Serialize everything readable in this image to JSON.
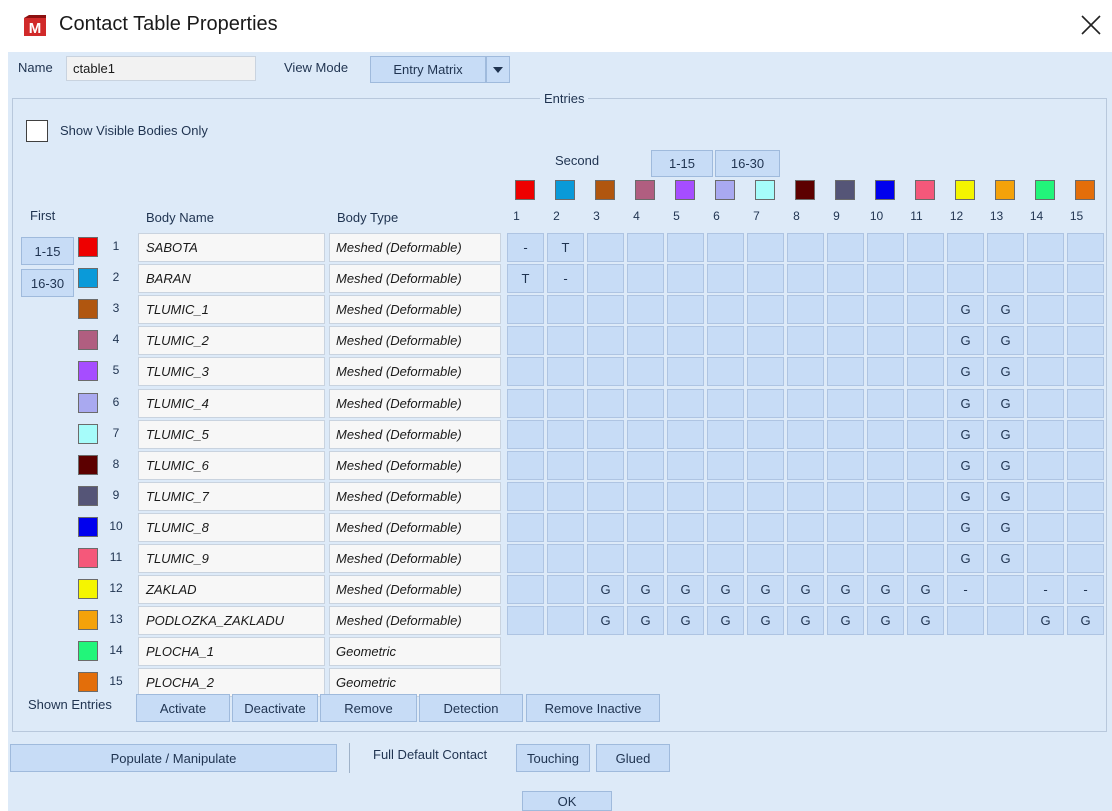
{
  "window": {
    "title": "Contact Table Properties"
  },
  "name_field": {
    "label": "Name",
    "value": "ctable1"
  },
  "view_mode": {
    "label": "View Mode",
    "selected": "Entry Matrix"
  },
  "entries_group": {
    "title": "Entries"
  },
  "show_visible_only": {
    "label": "Show Visible Bodies Only",
    "checked": false
  },
  "second": {
    "label": "Second",
    "range_buttons": [
      "1-15",
      "16-30"
    ]
  },
  "first": {
    "label": "First",
    "range_buttons": [
      "1-15",
      "16-30"
    ]
  },
  "headers": {
    "body_name": "Body Name",
    "body_type": "Body Type"
  },
  "bodies": [
    {
      "id": "1",
      "name": "SABOTA",
      "type": "Meshed (Deformable)",
      "color": "#ee0000"
    },
    {
      "id": "2",
      "name": "BARAN",
      "type": "Meshed (Deformable)",
      "color": "#0a9ad9"
    },
    {
      "id": "3",
      "name": "TLUMIC_1",
      "type": "Meshed (Deformable)",
      "color": "#b0560f"
    },
    {
      "id": "4",
      "name": "TLUMIC_2",
      "type": "Meshed (Deformable)",
      "color": "#b05e80"
    },
    {
      "id": "5",
      "name": "TLUMIC_3",
      "type": "Meshed (Deformable)",
      "color": "#a64dff"
    },
    {
      "id": "6",
      "name": "TLUMIC_4",
      "type": "Meshed (Deformable)",
      "color": "#a9a9f0"
    },
    {
      "id": "7",
      "name": "TLUMIC_5",
      "type": "Meshed (Deformable)",
      "color": "#a6fcfa"
    },
    {
      "id": "8",
      "name": "TLUMIC_6",
      "type": "Meshed (Deformable)",
      "color": "#5c0000"
    },
    {
      "id": "9",
      "name": "TLUMIC_7",
      "type": "Meshed (Deformable)",
      "color": "#555577"
    },
    {
      "id": "10",
      "name": "TLUMIC_8",
      "type": "Meshed (Deformable)",
      "color": "#0000ee"
    },
    {
      "id": "11",
      "name": "TLUMIC_9",
      "type": "Meshed (Deformable)",
      "color": "#f5587a"
    },
    {
      "id": "12",
      "name": "ZAKLAD",
      "type": "Meshed (Deformable)",
      "color": "#f5f500"
    },
    {
      "id": "13",
      "name": "PODLOZKA_ZAKLADU",
      "type": "Meshed (Deformable)",
      "color": "#f5a20a"
    },
    {
      "id": "14",
      "name": "PLOCHA_1",
      "type": "Geometric",
      "color": "#22f57a"
    },
    {
      "id": "15",
      "name": "PLOCHA_2",
      "type": "Geometric",
      "color": "#e36e0a"
    }
  ],
  "matrix": [
    [
      "-",
      "T",
      "",
      "",
      "",
      "",
      "",
      "",
      "",
      "",
      "",
      "",
      "",
      "",
      ""
    ],
    [
      "T",
      "-",
      "",
      "",
      "",
      "",
      "",
      "",
      "",
      "",
      "",
      "",
      "",
      "",
      ""
    ],
    [
      "",
      "",
      "",
      "",
      "",
      "",
      "",
      "",
      "",
      "",
      "",
      "G",
      "G",
      "",
      ""
    ],
    [
      "",
      "",
      "",
      "",
      "",
      "",
      "",
      "",
      "",
      "",
      "",
      "G",
      "G",
      "",
      ""
    ],
    [
      "",
      "",
      "",
      "",
      "",
      "",
      "",
      "",
      "",
      "",
      "",
      "G",
      "G",
      "",
      ""
    ],
    [
      "",
      "",
      "",
      "",
      "",
      "",
      "",
      "",
      "",
      "",
      "",
      "G",
      "G",
      "",
      ""
    ],
    [
      "",
      "",
      "",
      "",
      "",
      "",
      "",
      "",
      "",
      "",
      "",
      "G",
      "G",
      "",
      ""
    ],
    [
      "",
      "",
      "",
      "",
      "",
      "",
      "",
      "",
      "",
      "",
      "",
      "G",
      "G",
      "",
      ""
    ],
    [
      "",
      "",
      "",
      "",
      "",
      "",
      "",
      "",
      "",
      "",
      "",
      "G",
      "G",
      "",
      ""
    ],
    [
      "",
      "",
      "",
      "",
      "",
      "",
      "",
      "",
      "",
      "",
      "",
      "G",
      "G",
      "",
      ""
    ],
    [
      "",
      "",
      "",
      "",
      "",
      "",
      "",
      "",
      "",
      "",
      "",
      "G",
      "G",
      "",
      ""
    ],
    [
      "",
      "",
      "G",
      "G",
      "G",
      "G",
      "G",
      "G",
      "G",
      "G",
      "G",
      "-",
      "",
      "-",
      "-"
    ],
    [
      "",
      "",
      "G",
      "G",
      "G",
      "G",
      "G",
      "G",
      "G",
      "G",
      "G",
      "",
      "",
      "G",
      "G"
    ]
  ],
  "shown_entries": {
    "label": "Shown Entries",
    "buttons": [
      "Activate",
      "Deactivate",
      "Remove",
      "Detection",
      "Remove Inactive"
    ]
  },
  "populate_button": "Populate / Manipulate",
  "full_default_contact": {
    "label": "Full Default Contact",
    "buttons": [
      "Touching",
      "Glued"
    ]
  },
  "ok_button": "OK",
  "icons": {
    "app": "app-logo-icon",
    "close": "close-icon",
    "dropdown": "chevron-down-icon"
  }
}
